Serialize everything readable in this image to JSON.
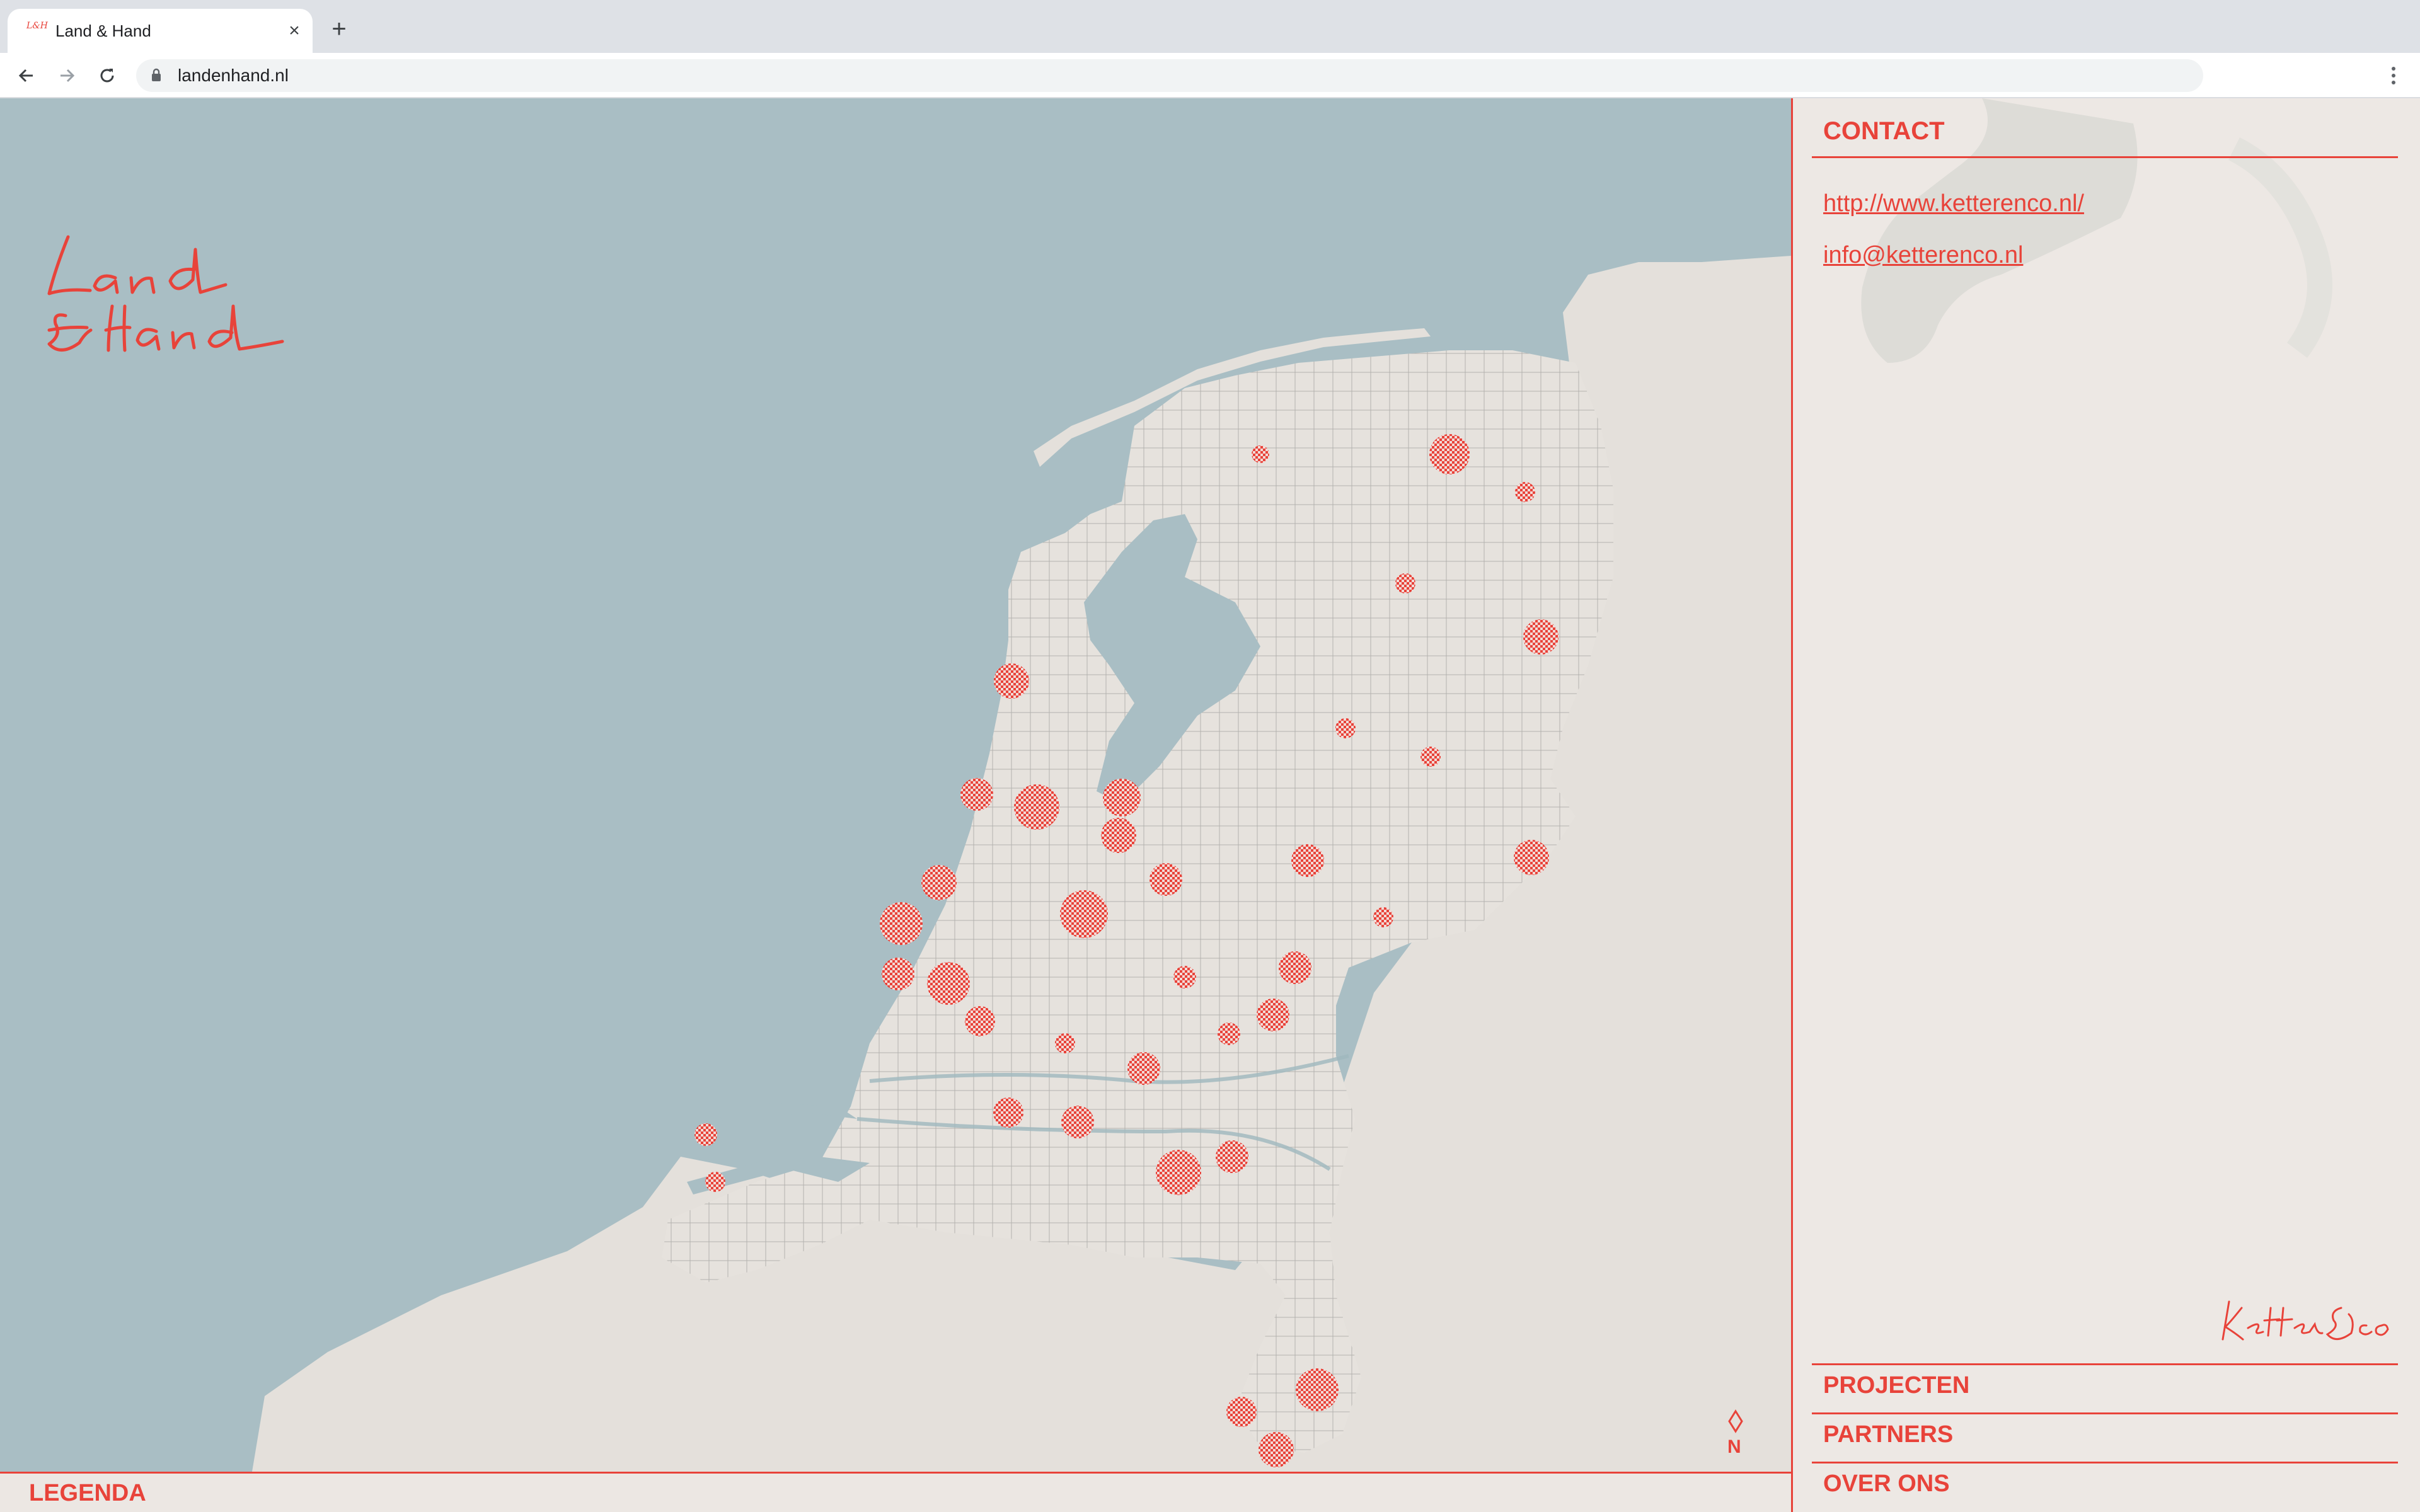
{
  "browser": {
    "tab_title": "Land & Hand",
    "favicon_text": "L&H",
    "close_glyph": "×",
    "new_tab_glyph": "+",
    "url": "landenhand.nl"
  },
  "logo": {
    "line1": "Land",
    "line2": "& Hand"
  },
  "map": {
    "compass_label": "N"
  },
  "legend": {
    "label": "LEGENDA"
  },
  "sidebar": {
    "contact_heading": "CONTACT",
    "links": [
      "http://www.ketterenco.nl/",
      "info@ketterenco.nl"
    ],
    "signature": "Ketter & co",
    "nav": [
      "PROJECTEN",
      "PARTNERS",
      "OVER ONS"
    ]
  },
  "colors": {
    "accent": "#e8433a",
    "sea": "#a9bec4",
    "land": "#e6e2dd",
    "paper": "#ede8e4"
  }
}
